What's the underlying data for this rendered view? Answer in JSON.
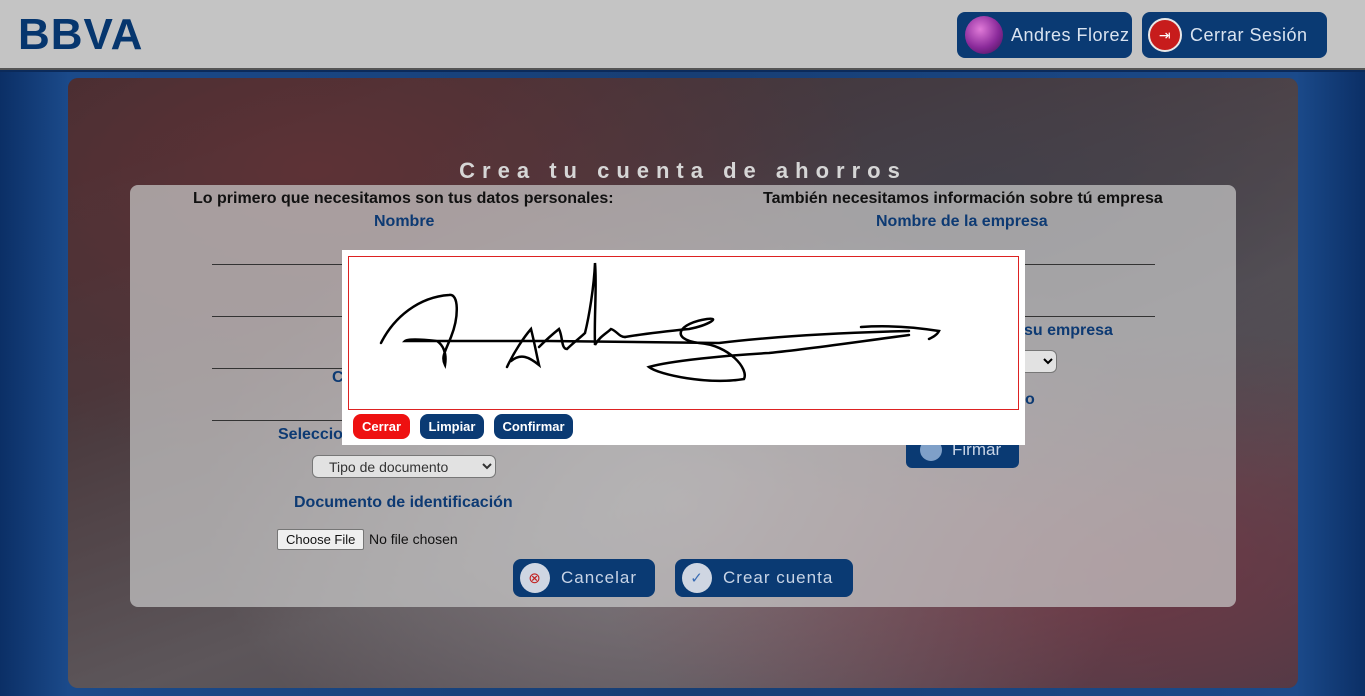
{
  "header": {
    "logo": "BBVA",
    "user_name": "Andres Florez",
    "logout_label": "Cerrar Sesión"
  },
  "page": {
    "title": "Crea tu cuenta de ahorros"
  },
  "form": {
    "left_title": "Lo primero que necesitamos son tus datos personales:",
    "name_label": "Nombre",
    "partial_label_c": "C",
    "doc_type_prompt_partial": "Seleccio",
    "doc_type_placeholder": "Tipo de documento",
    "doc_label": "Documento de identificación",
    "file_button_label": "Choose File",
    "file_status": "No file chosen",
    "right_title": "También necesitamos información sobre tú empresa",
    "company_name_label": "Nombre de la empresa",
    "company_partial_label": "su empresa",
    "partial_label_o": "o",
    "finish_label": "Firmar",
    "cancel_label": "Cancelar",
    "create_label": "Crear cuenta"
  },
  "modal": {
    "close_label": "Cerrar",
    "clear_label": "Limpiar",
    "confirm_label": "Confirmar"
  },
  "icons": {
    "user": "avatar",
    "logout": "logout-icon",
    "cancel": "x-circle-icon",
    "create": "check-circle-icon",
    "sign": "pen-icon"
  },
  "colors": {
    "brand": "#0a3a73",
    "danger": "#ee1111",
    "canvas_border": "#dd2222"
  }
}
